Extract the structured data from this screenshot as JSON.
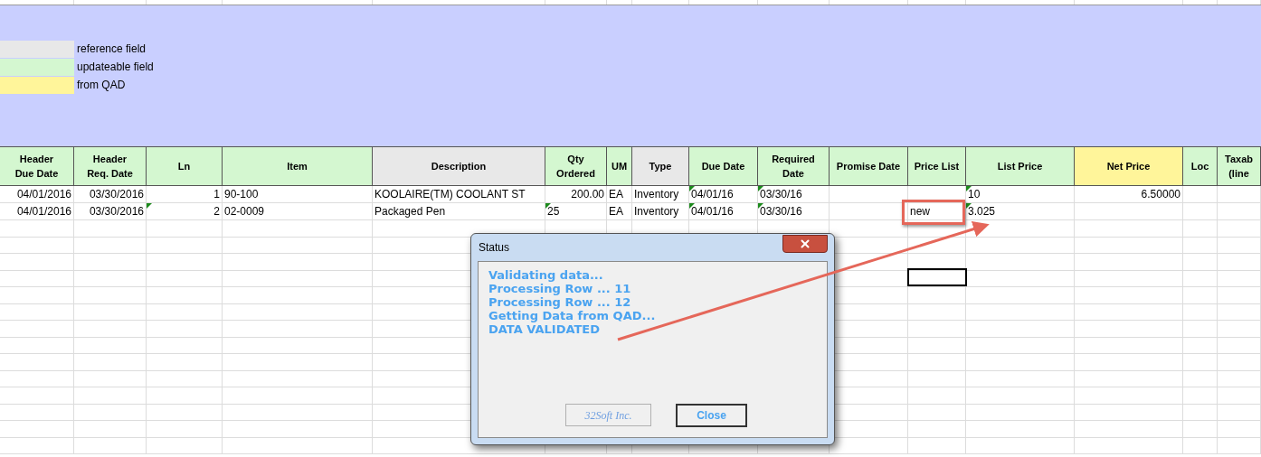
{
  "legend": [
    {
      "label": "reference field",
      "color": "#e8e8e8"
    },
    {
      "label": "updateable field",
      "color": "#d4f7d0"
    },
    {
      "label": "from QAD",
      "color": "#fff59a"
    }
  ],
  "table": {
    "columns": [
      {
        "label": "Header Due Date",
        "color": "#d4f7d0"
      },
      {
        "label": "Header Req. Date",
        "color": "#d4f7d0"
      },
      {
        "label": "Ln",
        "color": "#d4f7d0"
      },
      {
        "label": "Item",
        "color": "#d4f7d0"
      },
      {
        "label": "Description",
        "color": "#e8e8e8"
      },
      {
        "label": "Qty Ordered",
        "color": "#d4f7d0"
      },
      {
        "label": "UM",
        "color": "#d4f7d0"
      },
      {
        "label": "Type",
        "color": "#e8e8e8"
      },
      {
        "label": "Due Date",
        "color": "#d4f7d0"
      },
      {
        "label": "Required Date",
        "color": "#d4f7d0"
      },
      {
        "label": "Promise Date",
        "color": "#d4f7d0"
      },
      {
        "label": "Price List",
        "color": "#d4f7d0"
      },
      {
        "label": "List Price",
        "color": "#d4f7d0"
      },
      {
        "label": "Net Price",
        "color": "#fff59a"
      },
      {
        "label": "Loc",
        "color": "#d4f7d0"
      },
      {
        "label": "Taxab (line",
        "color": "#d4f7d0"
      }
    ],
    "rows": [
      {
        "cells": [
          {
            "text": "04/01/2016",
            "kind": "number"
          },
          {
            "text": "03/30/2016",
            "kind": "number"
          },
          {
            "text": "1",
            "kind": "number"
          },
          {
            "text": "90-100",
            "kind": "text"
          },
          {
            "text": "KOOLAIRE(TM) COOLANT ST",
            "kind": "text"
          },
          {
            "text": "200.00",
            "kind": "number"
          },
          {
            "text": "EA",
            "kind": "text"
          },
          {
            "text": "Inventory",
            "kind": "text"
          },
          {
            "text": "04/01/16",
            "kind": "text",
            "flag": true
          },
          {
            "text": "03/30/16",
            "kind": "text",
            "flag": true
          },
          {
            "kind": "empty"
          },
          {
            "kind": "empty"
          },
          {
            "text": "10",
            "kind": "text",
            "flag": true
          },
          {
            "text": "6.50000",
            "kind": "number"
          },
          {
            "kind": "empty"
          },
          {
            "kind": "empty"
          }
        ]
      },
      {
        "cells": [
          {
            "text": "04/01/2016",
            "kind": "number"
          },
          {
            "text": "03/30/2016",
            "kind": "number"
          },
          {
            "text": "2",
            "kind": "number",
            "flag": true
          },
          {
            "text": "02-0009",
            "kind": "text"
          },
          {
            "text": "Packaged Pen",
            "kind": "text"
          },
          {
            "text": "25",
            "kind": "text",
            "flag": true
          },
          {
            "text": "EA",
            "kind": "text"
          },
          {
            "text": "Inventory",
            "kind": "text"
          },
          {
            "text": "04/01/16",
            "kind": "text",
            "flag": true
          },
          {
            "text": "03/30/16",
            "kind": "text",
            "flag": true
          },
          {
            "kind": "empty"
          },
          {
            "text": "new",
            "kind": "text"
          },
          {
            "text": "3.025",
            "kind": "text",
            "flag": true
          },
          {
            "kind": "empty"
          },
          {
            "kind": "empty"
          },
          {
            "kind": "empty"
          }
        ]
      }
    ]
  },
  "dialog": {
    "title": "Status",
    "messages": [
      "Validating data...",
      "Processing Row ... 11",
      "Processing Row ... 12",
      "Getting Data from QAD...",
      "DATA VALIDATED"
    ],
    "buttons": [
      {
        "label": "32Soft Inc.",
        "disabled": true
      },
      {
        "label": "Close",
        "disabled": false
      }
    ]
  }
}
